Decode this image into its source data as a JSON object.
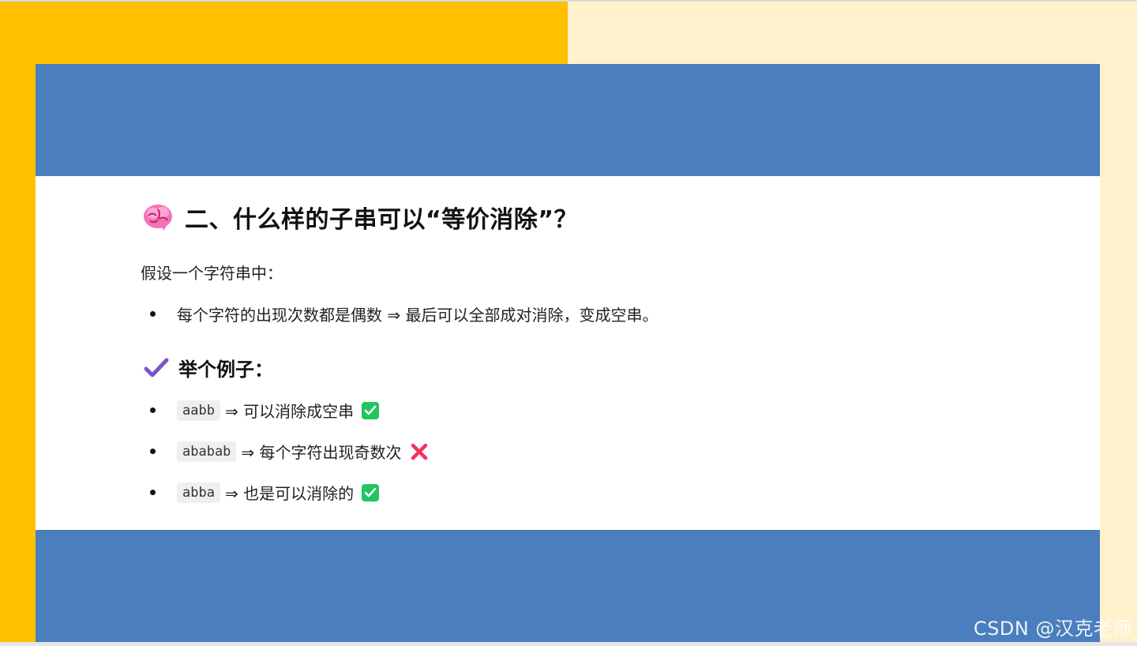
{
  "heading": {
    "title": "二、什么样的子串可以“等价消除”？",
    "icon": "brain-icon"
  },
  "intro": "假设一个字符串中：",
  "rule": {
    "text": "每个字符的出现次数都是偶数 ⇒ 最后可以全部成对消除，变成空串。"
  },
  "examples": {
    "title": "举个例子：",
    "icon": "heavy-check-icon",
    "items": [
      {
        "code": "aabb",
        "text": "⇒ 可以消除成空串",
        "status": "check-box-icon"
      },
      {
        "code": "ababab",
        "text": "⇒ 每个字符出现奇数次",
        "status": "cross-mark-icon"
      },
      {
        "code": "abba",
        "text": "⇒ 也是可以消除的",
        "status": "check-box-icon"
      }
    ]
  },
  "watermark": "CSDN @汉克老师",
  "colors": {
    "left_bg": "#FFC000",
    "right_bg": "#FFF1CC",
    "band": "#4A7EBD",
    "check_green": "#22C55E",
    "cross_red": "#F0355C",
    "check_purple": "#7B55C7"
  }
}
